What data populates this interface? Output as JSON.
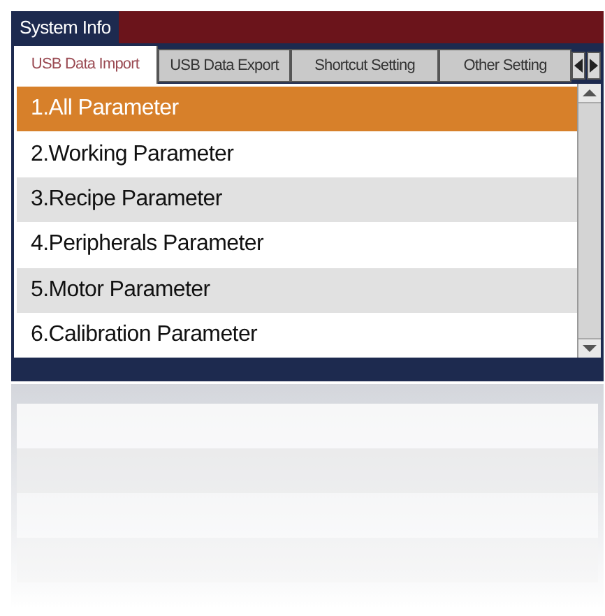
{
  "window": {
    "title": "System Info"
  },
  "tabs": [
    {
      "label": "USB Data Import",
      "selected": true
    },
    {
      "label": "USB Data Export",
      "selected": false
    },
    {
      "label": "Shortcut Setting",
      "selected": false
    },
    {
      "label": "Other Setting",
      "selected": false
    }
  ],
  "list": {
    "items": [
      {
        "label": "1.All Parameter",
        "selected": true
      },
      {
        "label": "2.Working Parameter",
        "selected": false
      },
      {
        "label": "3.Recipe Parameter",
        "selected": false
      },
      {
        "label": "4.Peripherals Parameter",
        "selected": false
      },
      {
        "label": "5.Motor Parameter",
        "selected": false
      },
      {
        "label": "6.Calibration Parameter",
        "selected": false
      }
    ]
  }
}
